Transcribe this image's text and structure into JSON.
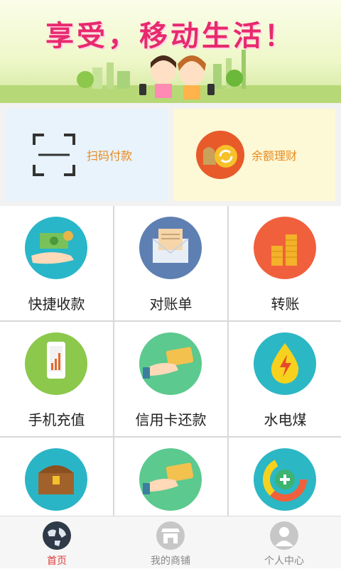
{
  "banner": {
    "title": "享受，移动生活！"
  },
  "top_cards": [
    {
      "label": "扫码付款",
      "icon": "scan-icon"
    },
    {
      "label": "余额理财",
      "icon": "coin-bag-icon"
    }
  ],
  "grid": [
    {
      "label": "快捷收款",
      "icon": "hand-cash-icon",
      "color": "#29b6c8"
    },
    {
      "label": "对账单",
      "icon": "envelope-icon",
      "color": "#5e7fb2"
    },
    {
      "label": "转账",
      "icon": "coin-stack-icon",
      "color": "#f0603c"
    },
    {
      "label": "手机充值",
      "icon": "phone-chart-icon",
      "color": "#8cc84b"
    },
    {
      "label": "信用卡还款",
      "icon": "card-payment-icon",
      "color": "#5cc98e"
    },
    {
      "label": "水电煤",
      "icon": "water-bolt-icon",
      "color": "#2cb7c4"
    },
    {
      "label": "",
      "icon": "treasure-chest-icon",
      "color": "#2ab5c6"
    },
    {
      "label": "",
      "icon": "card-hand-icon",
      "color": "#5cc98e"
    },
    {
      "label": "",
      "icon": "pie-plus-icon",
      "color": "#2cb7c4"
    }
  ],
  "tabs": [
    {
      "label": "首页",
      "icon": "globe-icon",
      "active": true
    },
    {
      "label": "我的商铺",
      "icon": "store-icon",
      "active": false
    },
    {
      "label": "个人中心",
      "icon": "user-icon",
      "active": false
    }
  ],
  "colors": {
    "accent": "#e23a3a",
    "banner_title": "#e8296e",
    "card_label": "#e88a1e"
  }
}
